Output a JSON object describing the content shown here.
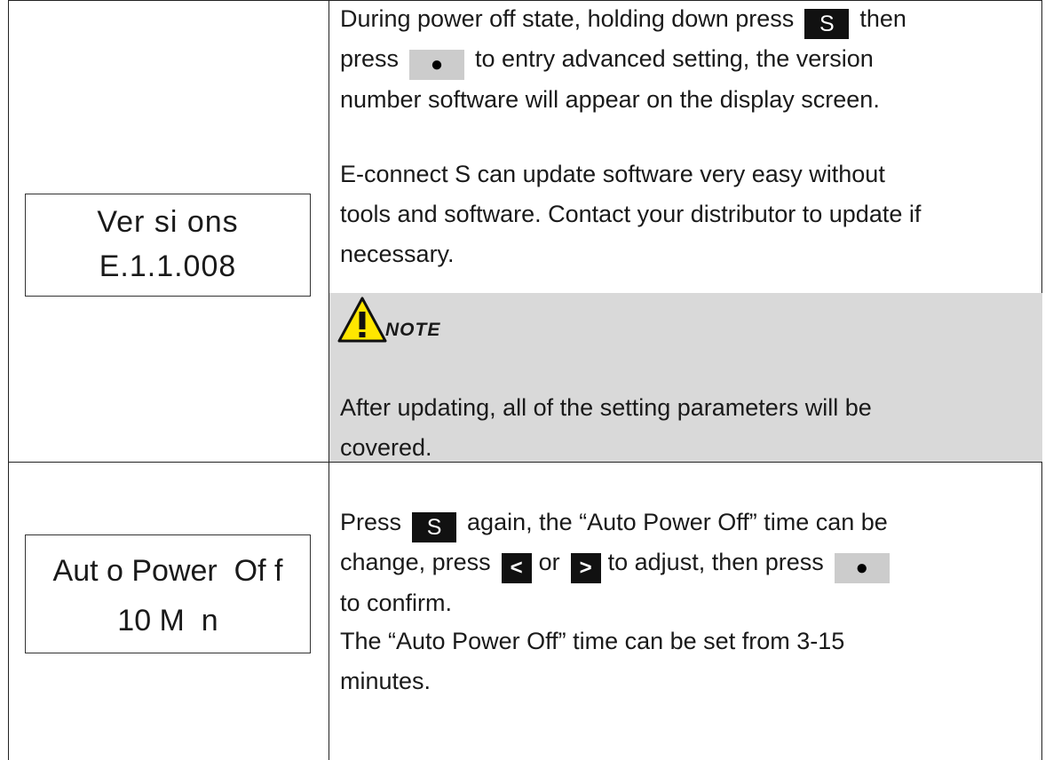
{
  "row1": {
    "lcd": {
      "line1": "Ver si ons",
      "line2": "E.1.1.008"
    },
    "para1": {
      "line1_a": "During power off state, holding down press",
      "line1_key": "S",
      "line1_b": "then",
      "line2_a": "press",
      "line2_key": "●",
      "line2_b": "to entry advanced setting, the version",
      "line3": "number software will appear on the display screen."
    },
    "para2": {
      "line1": "E-connect S can update software very easy without",
      "line2": "tools and software. Contact your distributor to update if",
      "line3": "necessary."
    },
    "note": {
      "label": "NOTE",
      "line1": "After updating, all of the setting parameters will be",
      "line2": "covered."
    }
  },
  "row2": {
    "lcd": {
      "line1": "Aut o Power  Of f",
      "line2": "10 M  n"
    },
    "para1": {
      "line1_a": "Press",
      "line1_key": "S",
      "line1_b": "again, the “Auto Power Off” time can be",
      "line2_a": "change, press",
      "line2_key_left": "<",
      "line2_or": "or",
      "line2_key_right": ">",
      "line2_b": "to adjust, then press",
      "line2_key_ok": "●",
      "line3": "to confirm."
    },
    "para2": {
      "line1": "The “Auto Power Off” time can be set from 3-15",
      "line2": "minutes."
    }
  },
  "colors": {
    "note_bg": "#d9d9d9",
    "key_dark": "#111111",
    "key_grey": "#cccccc",
    "warning_yellow": "#ffe600"
  }
}
